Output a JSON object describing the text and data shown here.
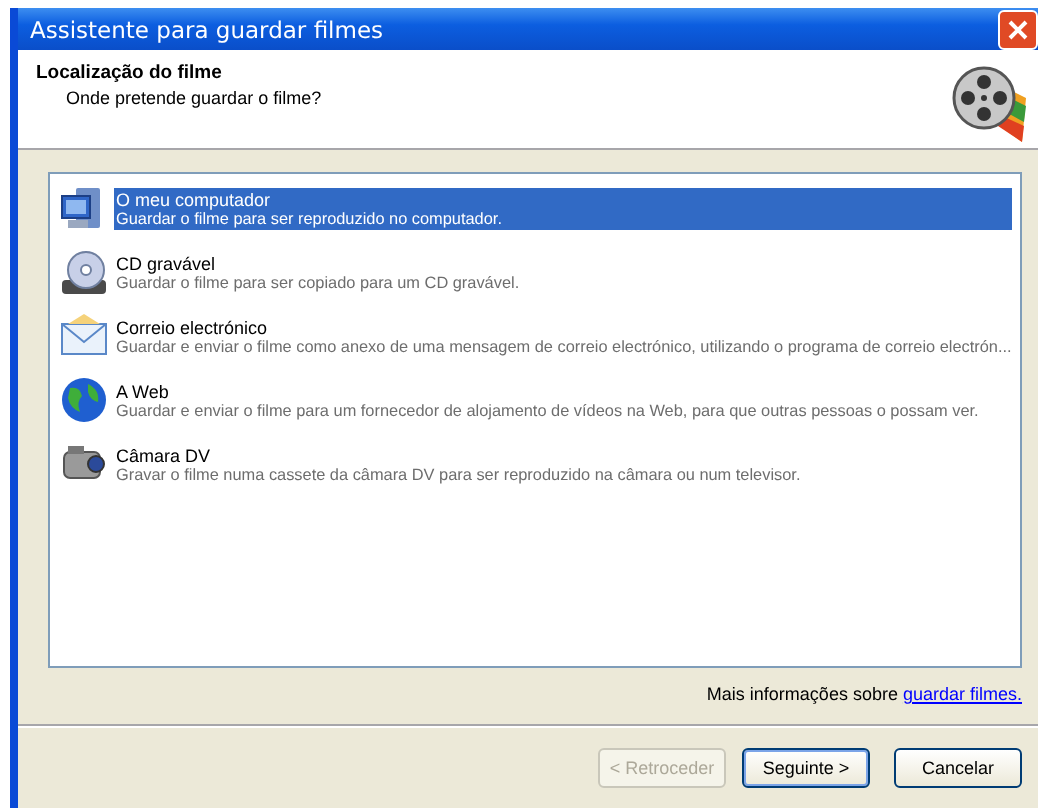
{
  "window": {
    "title": "Assistente para guardar filmes"
  },
  "header": {
    "title": "Localização do filme",
    "subtitle": "Onde pretende guardar o filme?"
  },
  "destinations": [
    {
      "kind": "computer",
      "title": "O meu computador",
      "description": "Guardar o filme para ser reproduzido no computador.",
      "selected": true
    },
    {
      "kind": "cd",
      "title": "CD gravável",
      "description": "Guardar o filme para ser copiado para um CD gravável.",
      "selected": false
    },
    {
      "kind": "mail",
      "title": "Correio electrónico",
      "description": "Guardar e enviar o filme como anexo de uma mensagem de correio electrónico, utilizando o programa de correio electrón...",
      "selected": false
    },
    {
      "kind": "web",
      "title": "A Web",
      "description": "Guardar e enviar o filme para um fornecedor de alojamento de vídeos na Web, para que outras pessoas o possam ver.",
      "selected": false
    },
    {
      "kind": "camera",
      "title": "Câmara DV",
      "description": "Gravar o filme numa cassete da câmara DV para ser reproduzido na câmara ou num televisor.",
      "selected": false
    }
  ],
  "more_info": {
    "text": "Mais informações sobre",
    "link": "guardar filmes."
  },
  "buttons": [
    {
      "label": "< Retroceder",
      "disabled": true,
      "default": false
    },
    {
      "label": "Seguinte >",
      "disabled": false,
      "default": true
    },
    {
      "label": "Cancelar",
      "disabled": false,
      "default": false
    }
  ]
}
